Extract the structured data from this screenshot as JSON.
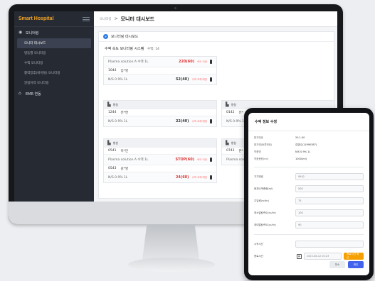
{
  "app": {
    "brand": "Smart Hospital"
  },
  "sidebar": {
    "groups": [
      {
        "label": "모니터링",
        "icon": "eye-icon"
      },
      {
        "label": "EMR 연동",
        "icon": "home-icon"
      }
    ],
    "items": [
      {
        "label": "모니터 대시보드",
        "active": true
      },
      {
        "label": "병동별 모니터링"
      },
      {
        "label": "수액 모니터링"
      },
      {
        "label": "활력징후(바이탈) 모니터링"
      },
      {
        "label": "알림이력 모니터링"
      }
    ]
  },
  "topbar": {
    "crumb": "모니터링",
    "separator": ">",
    "title": "모니터 대시보드"
  },
  "panel": {
    "title": "모니터링 대시보드",
    "section": "수액 속도 모니터링 시스템",
    "count": "수액: 14"
  },
  "cards": [
    {
      "bed": "",
      "rows": [
        {
          "name": "Plasma solution A 수액 1L",
          "rate": "220(60)",
          "tag": "속도 이상"
        }
      ],
      "patient": {
        "room": "1044",
        "name": "임*영"
      },
      "rows2": [
        {
          "name": "N/S 0.9% 1L",
          "rate": "52(40)",
          "tag": "수액 교체 예정"
        }
      ]
    },
    {
      "bed": "병실",
      "patient": {
        "room": "1244",
        "name": "전*연"
      },
      "rows": [
        {
          "name": "N/S 0.9% 1L",
          "rate": "22(40)",
          "tag": "수액 교체 예정"
        }
      ]
    },
    {
      "bed": "병실",
      "patient": {
        "room": "0142",
        "name": "전*"
      },
      "rows": [
        {
          "name": "N/S 0.9% 1L",
          "rate": "",
          "tag": ""
        }
      ]
    },
    {
      "bed": "병실",
      "patient": {
        "room": "0541",
        "name": "이*민"
      },
      "rows": [
        {
          "name": "Plasma solution A 수액 1L",
          "rate": "STOP(60)",
          "tag": "속도 이상"
        }
      ],
      "patient2": {
        "room": "0543",
        "name": "김*영"
      },
      "rows2": [
        {
          "name": "N/S 0.9% 1L",
          "rate": "24(60)",
          "tag": "수액 교체 예정"
        }
      ]
    },
    {
      "bed": "병실",
      "patient": {
        "room": "0743",
        "name": "한*"
      },
      "rows": [
        {
          "name": "Plasma solution A",
          "rate": "",
          "tag": ""
        }
      ]
    }
  ],
  "tablet": {
    "title": "수액 정보 수정",
    "info": [
      {
        "k": "환자번호",
        "v": "20.1.00"
      },
      {
        "k": "환자명(등록번호)",
        "v": "김영수(11990387)"
      },
      {
        "k": "약품명",
        "v": "N/S 0.9% 1L"
      },
      {
        "k": "약품용량(ml)",
        "v": "1000(ml)"
      }
    ],
    "inputs": [
      {
        "k": "기기번호",
        "v": "9542"
      },
      {
        "k": "현재수액총량(ml)",
        "v": "500"
      },
      {
        "k": "주입량(cc/hr)",
        "v": "75"
      },
      {
        "k": "최소알림속도(cc/hr)",
        "v": "100"
      },
      {
        "k": "최대알림속도(cc/hr)",
        "v": "90"
      }
    ],
    "start_label": "시작시간",
    "start_placeholder": "",
    "end_label": "종료시간",
    "end_value": "2023-08-12 00:23",
    "auto_button": "종료시간 계산",
    "cancel": "취소",
    "ok": "확인"
  }
}
